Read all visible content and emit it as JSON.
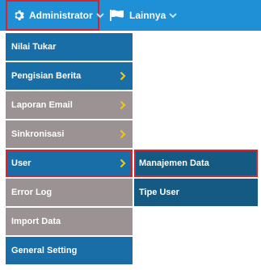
{
  "topbar": {
    "administrator_label": "Administrator",
    "lainnya_label": "Lainnya",
    "bg_color": "#1f8fd6"
  },
  "menu": {
    "items": [
      {
        "label": "Nilai Tukar",
        "has_submenu": false,
        "style": "blue"
      },
      {
        "label": "Pengisian Berita",
        "has_submenu": true,
        "style": "blue"
      },
      {
        "label": "Laporan Email",
        "has_submenu": true,
        "style": "gray"
      },
      {
        "label": "Sinkronisasi",
        "has_submenu": true,
        "style": "gray"
      },
      {
        "label": "User",
        "has_submenu": true,
        "style": "selected"
      },
      {
        "label": "Error Log",
        "has_submenu": false,
        "style": "gray"
      },
      {
        "label": "Import Data",
        "has_submenu": false,
        "style": "gray"
      },
      {
        "label": "General Setting",
        "has_submenu": false,
        "style": "blue"
      }
    ]
  },
  "submenu": {
    "items": [
      {
        "label": "Manajemen Data"
      },
      {
        "label": "Tipe User"
      }
    ]
  },
  "colors": {
    "menu_blue": "#1a6ea8",
    "menu_gray": "#9b9393",
    "submenu_bg": "#155a82",
    "highlight": "#d9232a",
    "arrow": "#f0c419"
  }
}
